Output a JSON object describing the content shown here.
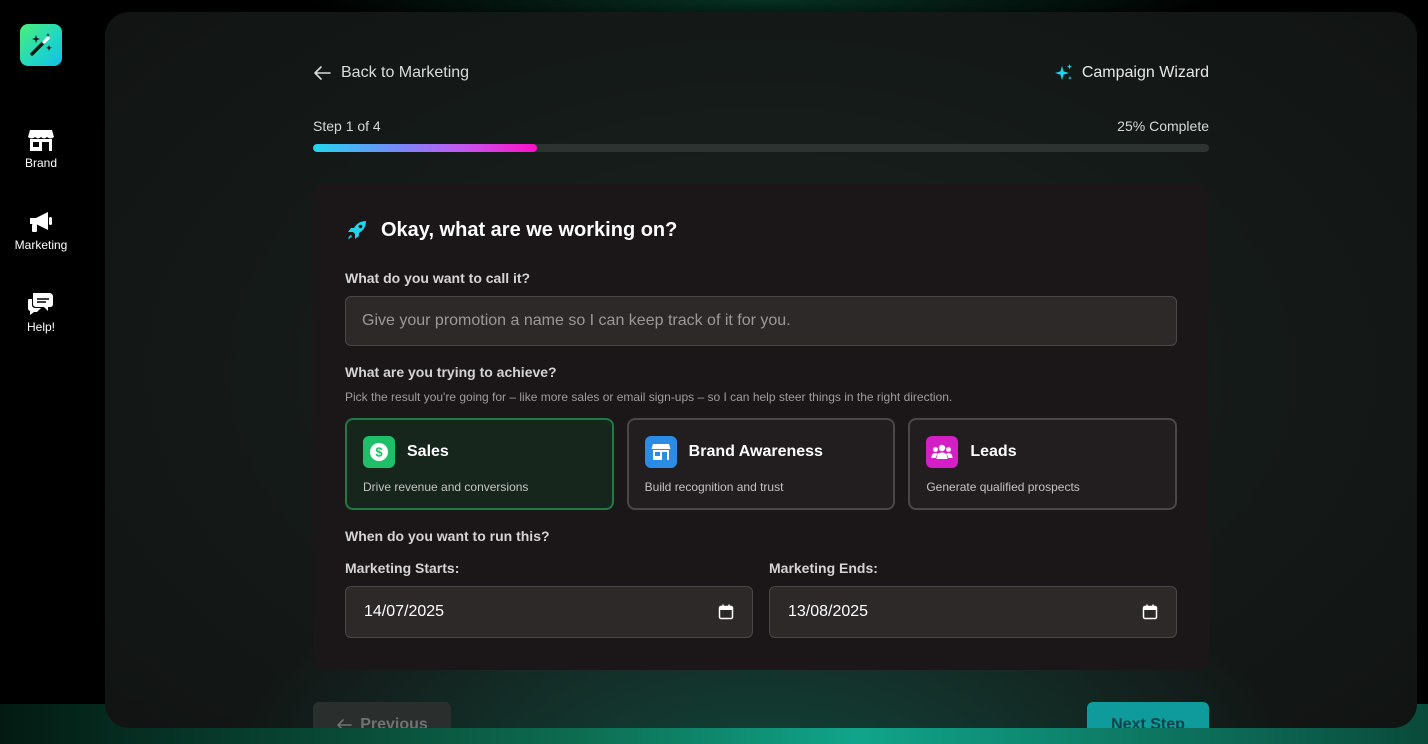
{
  "sidebar": {
    "items": [
      {
        "label": "Brand",
        "icon": "store-icon"
      },
      {
        "label": "Marketing",
        "icon": "megaphone-icon"
      },
      {
        "label": "Help!",
        "icon": "chat-bubbles-icon"
      }
    ]
  },
  "header": {
    "back_label": "Back to Marketing",
    "wizard_title": "Campaign Wizard"
  },
  "progress": {
    "step_text": "Step 1 of 4",
    "complete_text": "25% Complete",
    "percent": 25
  },
  "form": {
    "title": "Okay, what are we working on?",
    "name_question": "What do you want to call it?",
    "name_value": "",
    "name_placeholder": "Give your promotion a name so I can keep track of it for you.",
    "goal_question": "What are you trying to achieve?",
    "goal_help": "Pick the result you're going for – like more sales or email sign-ups – so I can help steer things in the right direction.",
    "goals": [
      {
        "name": "Sales",
        "desc": "Drive revenue and conversions",
        "color": "#1fbf6a",
        "selected": true
      },
      {
        "name": "Brand Awareness",
        "desc": "Build recognition and trust",
        "color": "#2b8ce6",
        "selected": false
      },
      {
        "name": "Leads",
        "desc": "Generate qualified prospects",
        "color": "#d31fc4",
        "selected": false
      }
    ],
    "date_question": "When do you want to run this?",
    "start_label": "Marketing Starts:",
    "start_value": "14/07/2025",
    "end_label": "Marketing Ends:",
    "end_value": "13/08/2025"
  },
  "footer": {
    "prev_label": "Previous",
    "next_label": "Next Step"
  }
}
